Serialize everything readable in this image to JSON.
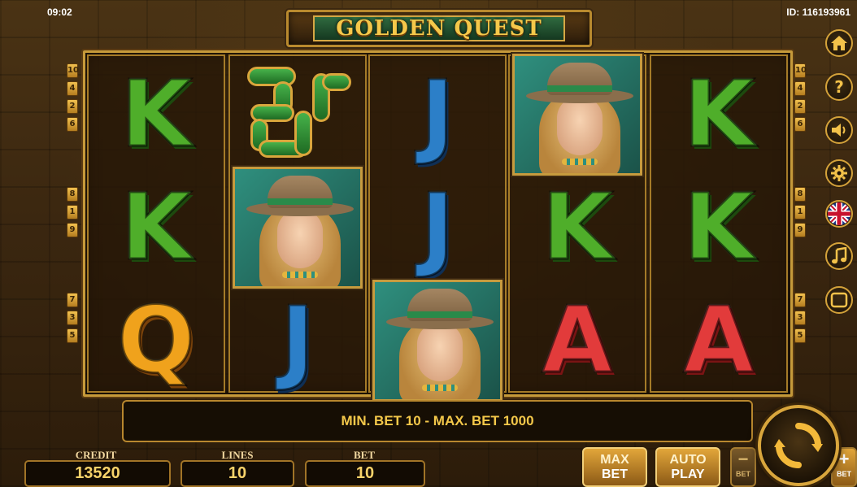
{
  "status": {
    "time": "09:02",
    "id_label": "ID: 116193961"
  },
  "title": "GOLDEN QUEST",
  "reels": [
    [
      "K",
      "K",
      "Q"
    ],
    [
      "serpent",
      "explorer",
      "J"
    ],
    [
      "J",
      "J",
      "explorer"
    ],
    [
      "explorer",
      "K",
      "A"
    ],
    [
      "K",
      "K",
      "A"
    ]
  ],
  "line_markers": {
    "left": [
      "10",
      "4",
      "2",
      "6",
      "8",
      "1",
      "9",
      "7",
      "3",
      "5"
    ],
    "right": [
      "10",
      "4",
      "2",
      "6",
      "8",
      "1",
      "9",
      "7",
      "3",
      "5"
    ]
  },
  "side_menu": [
    "home-icon",
    "help-icon",
    "sound-icon",
    "settings-icon",
    "language-flag-icon",
    "music-icon",
    "fullscreen-icon"
  ],
  "message": "MIN. BET 10 - MAX. BET 1000",
  "stats": {
    "credit_label": "CREDIT",
    "credit_value": "13520",
    "lines_label": "LINES",
    "lines_value": "10",
    "bet_label": "BET",
    "bet_value": "10"
  },
  "buttons": {
    "max_top": "MAX",
    "max_bottom": "BET",
    "auto_top": "AUTO",
    "auto_bottom": "PLAY",
    "minus_sign": "−",
    "minus_label": "BET",
    "plus_sign": "+",
    "plus_label": "BET"
  },
  "colors": {
    "gold": "#f4c84a",
    "frame": "#c69a3a"
  }
}
